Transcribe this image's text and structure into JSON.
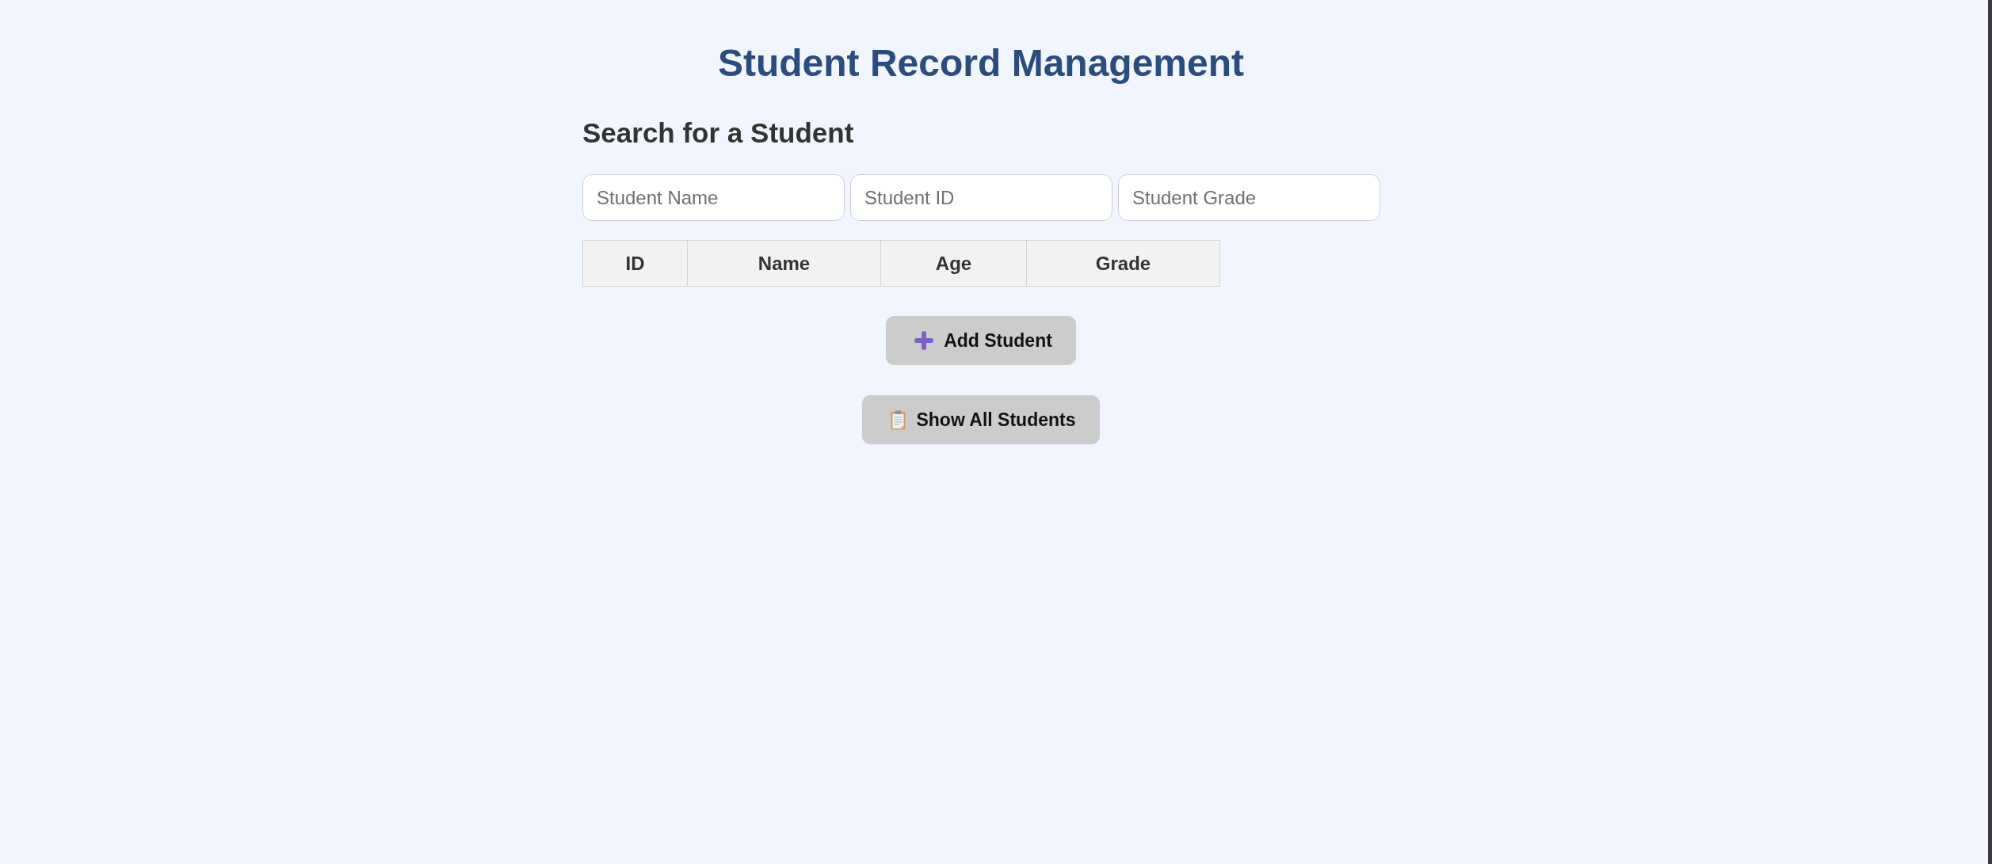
{
  "title": "Student Record Management",
  "search": {
    "heading": "Search for a Student",
    "fields": [
      {
        "placeholder": "Student Name"
      },
      {
        "placeholder": "Student ID"
      },
      {
        "placeholder": "Student Grade"
      }
    ]
  },
  "table": {
    "columns": [
      "ID",
      "Name",
      "Age",
      "Grade"
    ]
  },
  "buttons": [
    {
      "kind": "add",
      "label": "Add Student"
    },
    {
      "kind": "list",
      "label": "Show All Students"
    }
  ]
}
